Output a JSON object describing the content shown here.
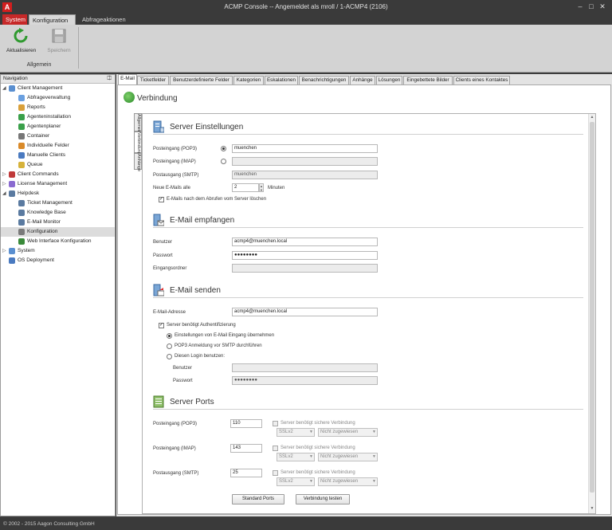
{
  "window": {
    "title": "ACMP Console -- Angemeldet als mroll / 1-ACMP4 (2106)",
    "app_icon": "A"
  },
  "ribbon": {
    "tabs": {
      "system": "System",
      "konfiguration": "Konfiguration",
      "abfrageaktionen": "Abfrageaktionen"
    },
    "buttons": {
      "refresh": "Aktualisieren",
      "save": "Speichern"
    },
    "group_label": "Allgemein"
  },
  "navigation": {
    "header": "Navigation",
    "items": [
      {
        "label": "Client Management",
        "icon": "client-management-icon"
      },
      {
        "label": "Abfrageverwaltung",
        "icon": "query-icon"
      },
      {
        "label": "Reports",
        "icon": "reports-icon"
      },
      {
        "label": "Agenteninstallation",
        "icon": "agent-install-icon"
      },
      {
        "label": "Agentenplaner",
        "icon": "agent-planner-icon"
      },
      {
        "label": "Container",
        "icon": "container-icon"
      },
      {
        "label": "Individuelle Felder",
        "icon": "custom-fields-icon"
      },
      {
        "label": "Manuelle Clients",
        "icon": "manual-clients-icon"
      },
      {
        "label": "Queue",
        "icon": "queue-icon"
      },
      {
        "label": "Client Commands",
        "icon": "client-commands-icon"
      },
      {
        "label": "License Management",
        "icon": "license-icon"
      },
      {
        "label": "Helpdesk",
        "icon": "helpdesk-icon"
      },
      {
        "label": "Ticket Management",
        "icon": "ticket-icon"
      },
      {
        "label": "Knowledge Base",
        "icon": "knowledge-icon"
      },
      {
        "label": "E-Mail Monitor",
        "icon": "email-monitor-icon"
      },
      {
        "label": "Konfiguration",
        "icon": "config-icon"
      },
      {
        "label": "Web Interface Konfiguration",
        "icon": "web-config-icon"
      },
      {
        "label": "System",
        "icon": "system-icon"
      },
      {
        "label": "OS Deployment",
        "icon": "os-deployment-icon"
      }
    ]
  },
  "tabs": [
    "E-Mail",
    "Ticketfelder",
    "Benutzerdefinierte Felder",
    "Kategorien",
    "Eskalationen",
    "Benachrichtigungen",
    "Anhänge",
    "Lösungen",
    "Eingebettete Bilder",
    "Clients eines Kontaktes"
  ],
  "page": {
    "title": "Verbindung"
  },
  "vertical_tabs": [
    "Allgemein",
    "Verbindung",
    "Anhänge"
  ],
  "server": {
    "title": "Server Einstellungen",
    "pop3_label": "Posteingang (POP3)",
    "pop3_value": "muenchen",
    "imap_label": "Posteingang (IMAP)",
    "imap_value": "",
    "smtp_label": "Postausgang (SMTP)",
    "smtp_value": "muenchen",
    "interval_label": "Neue E-Mails alle",
    "interval_value": "2",
    "interval_unit": "Minuten",
    "delete_label": "E-Mails nach dem Abrufen vom Server löschen"
  },
  "receive": {
    "title": "E-Mail empfangen",
    "user_label": "Benutzer",
    "user_value": "acmp4@muenchen.local",
    "password_label": "Passwort",
    "password_value": "●●●●●●●●",
    "folder_label": "Eingangsordner",
    "folder_value": ""
  },
  "send": {
    "title": "E-Mail senden",
    "address_label": "E-Mail-Adresse",
    "address_value": "acmp4@muenchen.local",
    "auth_label": "Server benötigt Authentifizierung",
    "opt1": "Einstellungen von E-Mail Eingang übernehmen",
    "opt2": "POP3 Anmeldung vor SMTP durchführen",
    "opt3": "Diesen Login benutzen:",
    "user_label": "Benutzer",
    "user_value": "",
    "password_label": "Passwort",
    "password_value": "●●●●●●●●"
  },
  "ports": {
    "title": "Server Ports",
    "rows": [
      {
        "label": "Posteingang (POP3)",
        "value": "110",
        "secure": "Server benötigt sichere Verbindung",
        "ssl": "SSLv2",
        "assign": "Nicht zugewiesen"
      },
      {
        "label": "Posteingang (IMAP)",
        "value": "143",
        "secure": "Server benötigt sichere Verbindung",
        "ssl": "SSLv2",
        "assign": "Nicht zugewiesen"
      },
      {
        "label": "Postausgang (SMTP)",
        "value": "25",
        "secure": "Server benötigt sichere Verbindung",
        "ssl": "SSLv2",
        "assign": "Nicht zugewiesen"
      }
    ],
    "standard_button": "Standard Ports",
    "test_button": "Verbindung testen"
  },
  "status": {
    "copyright": "© 2002 - 2015 Aagon Consulting GmbH"
  },
  "colors": {
    "system_tab": "#c62828",
    "accent_green": "#2a8a2a"
  }
}
